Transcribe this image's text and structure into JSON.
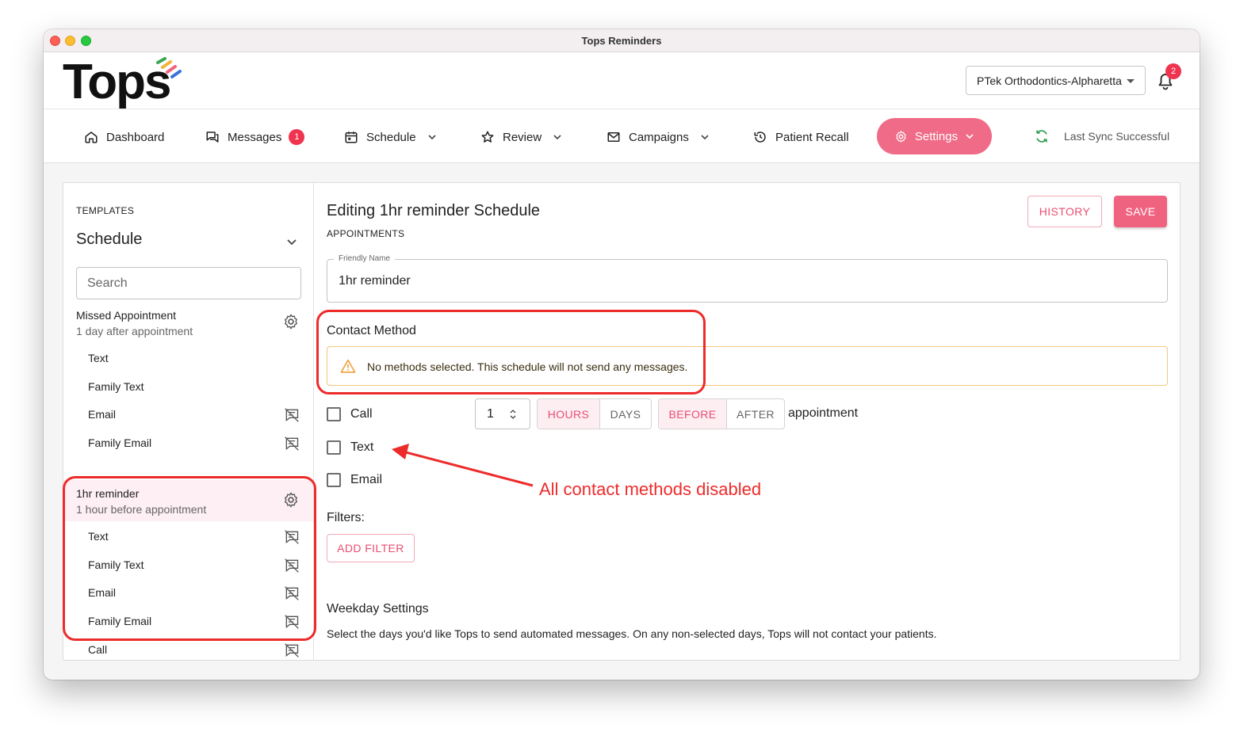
{
  "window": {
    "title": "Tops Reminders"
  },
  "header": {
    "logo_text": "Tops",
    "practice": "PTek Orthodontics-Alpharetta",
    "notification_count": "2"
  },
  "nav": {
    "dashboard": "Dashboard",
    "messages": "Messages",
    "messages_badge": "1",
    "schedule": "Schedule",
    "review": "Review",
    "campaigns": "Campaigns",
    "patient_recall": "Patient Recall",
    "settings": "Settings",
    "sync_status": "Last Sync Successful"
  },
  "sidebar": {
    "section_label": "TEMPLATES",
    "selected_type": "Schedule",
    "search_placeholder": "Search",
    "groups": [
      {
        "title": "Missed Appointment",
        "subtitle": "1 day after appointment",
        "channels": [
          {
            "label": "Text",
            "disabled_icon": false
          },
          {
            "label": "Family Text",
            "disabled_icon": false
          },
          {
            "label": "Email",
            "disabled_icon": true
          },
          {
            "label": "Family Email",
            "disabled_icon": true
          }
        ]
      },
      {
        "title": "1hr reminder",
        "subtitle": "1 hour before appointment",
        "channels": [
          {
            "label": "Text",
            "disabled_icon": true
          },
          {
            "label": "Family Text",
            "disabled_icon": true
          },
          {
            "label": "Email",
            "disabled_icon": true
          },
          {
            "label": "Family Email",
            "disabled_icon": true
          },
          {
            "label": "Call",
            "disabled_icon": true
          }
        ]
      }
    ]
  },
  "editor": {
    "title": "Editing 1hr reminder Schedule",
    "subtitle": "APPOINTMENTS",
    "history_label": "HISTORY",
    "save_label": "SAVE",
    "friendly_name_label": "Friendly Name",
    "friendly_name_value": "1hr reminder",
    "contact_method_title": "Contact Method",
    "warning_text": "No methods selected. This schedule will not send any messages.",
    "methods": [
      {
        "label": "Call",
        "checked": false
      },
      {
        "label": "Text",
        "checked": false
      },
      {
        "label": "Email",
        "checked": false
      }
    ],
    "timing": {
      "amount": "1",
      "unit_options": [
        "HOURS",
        "DAYS"
      ],
      "selected_unit": "HOURS",
      "relation_options": [
        "BEFORE",
        "AFTER"
      ],
      "selected_relation": "BEFORE",
      "suffix": "appointment"
    },
    "filters_label": "Filters:",
    "add_filter_label": "ADD FILTER",
    "weekday_title": "Weekday Settings",
    "weekday_desc": "Select the days you'd like Tops to send automated messages. On any non-selected days, Tops will not contact your patients."
  },
  "annotation": {
    "text": "All contact methods disabled"
  },
  "colors": {
    "accent": "#f06380",
    "badge": "#f0334f",
    "annotation": "#ee2b2b",
    "warning_border": "#f3c87a"
  }
}
